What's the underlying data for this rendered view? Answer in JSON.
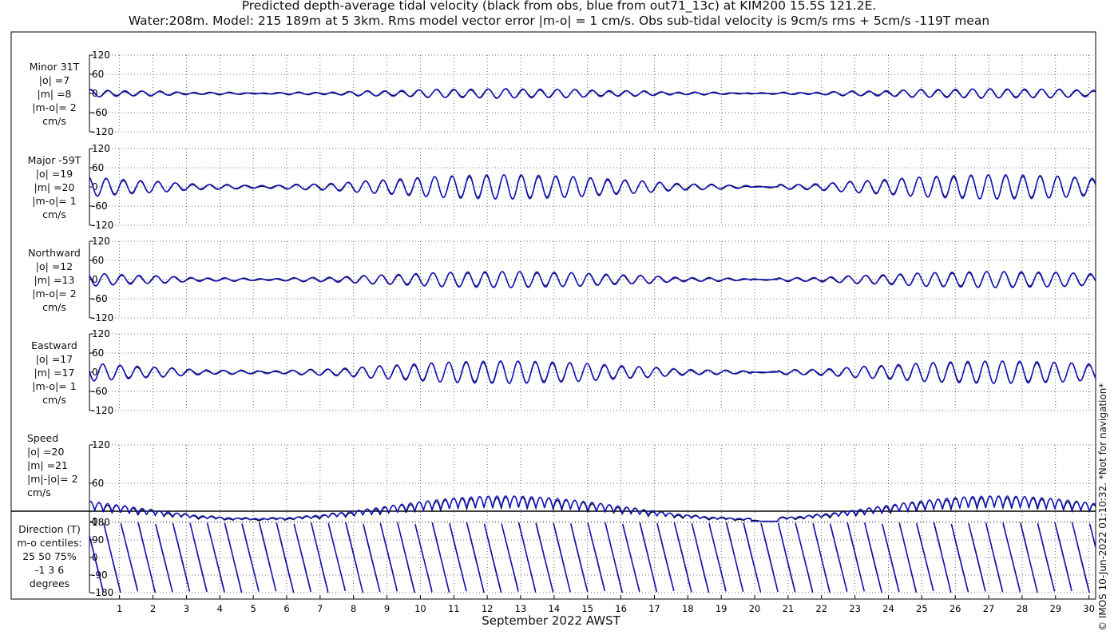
{
  "header": {
    "title_line1": "Predicted depth-average tidal velocity (black from obs, blue from out71_13c) at KIM200 15.5S 121.2E.",
    "title_line2": "Water:208m. Model: 215 189m at 5 3km. Rms model vector error |m-o| = 1 cm/s. Obs sub-tidal velocity is 9cm/s rms + 5cm/s -119T mean"
  },
  "panels": [
    {
      "lines": [
        "Minor 31T",
        "|o| =7",
        "|m| =8",
        "|m-o|= 2",
        "cm/s"
      ]
    },
    {
      "lines": [
        "Major -59T",
        "|o| =19",
        "|m| =20",
        "|m-o|= 1",
        "cm/s"
      ]
    },
    {
      "lines": [
        "Northward",
        "|o| =12",
        "|m| =13",
        "|m-o|= 2",
        "cm/s"
      ]
    },
    {
      "lines": [
        "Eastward",
        "|o| =17",
        "|m| =17",
        "|m-o|= 1",
        "cm/s"
      ]
    },
    {
      "lines": [
        "Speed",
        "|o| =20",
        "|m| =21",
        "|m|-|o|= 2",
        "cm/s"
      ]
    },
    {
      "lines": [
        "Direction (T)",
        "m-o centiles:",
        "25  50  75%",
        "-1  3  6",
        "degrees"
      ]
    }
  ],
  "x_axis_label": "September 2022 AWST",
  "watermark": "© IMOS 10-Jun-2022 01:10:32. *Not for navigation*",
  "colors": {
    "obs": "#000000",
    "model": "#1010c8",
    "grid": "#444444"
  },
  "chart_data": {
    "type": "line",
    "x_unit": "day of September 2022",
    "x_range": [
      0.1,
      30.2
    ],
    "x_ticks": [
      1,
      2,
      3,
      4,
      5,
      6,
      7,
      8,
      9,
      10,
      11,
      12,
      13,
      14,
      15,
      16,
      17,
      18,
      19,
      20,
      21,
      22,
      23,
      24,
      25,
      26,
      27,
      28,
      29,
      30
    ],
    "series": [
      {
        "name": "black from obs"
      },
      {
        "name": "blue from out71_13c"
      }
    ],
    "panels": [
      {
        "id": "minor",
        "ylim": [
          -120,
          120
        ],
        "yticks": [
          -120,
          -60,
          0,
          60,
          120
        ],
        "rms_obs": 7,
        "rms_model": 8,
        "rms_error": 2
      },
      {
        "id": "major",
        "ylim": [
          -120,
          120
        ],
        "yticks": [
          -120,
          -60,
          0,
          60,
          120
        ],
        "rms_obs": 19,
        "rms_model": 20,
        "rms_error": 1
      },
      {
        "id": "northward",
        "ylim": [
          -120,
          120
        ],
        "yticks": [
          -120,
          -60,
          0,
          60,
          120
        ],
        "rms_obs": 12,
        "rms_model": 13,
        "rms_error": 2
      },
      {
        "id": "eastward",
        "ylim": [
          -120,
          120
        ],
        "yticks": [
          -120,
          -60,
          0,
          60,
          120
        ],
        "rms_obs": 17,
        "rms_model": 17,
        "rms_error": 1
      },
      {
        "id": "speed",
        "ylim": [
          0,
          120
        ],
        "yticks": [
          0,
          60,
          120
        ],
        "rms_obs": 20,
        "rms_model": 21,
        "rms_error": 2
      },
      {
        "id": "direction",
        "ylim": [
          -180,
          180
        ],
        "yticks": [
          -180,
          -90,
          0,
          90,
          180
        ],
        "centiles": [
          -1,
          3,
          6
        ]
      }
    ],
    "tidal_signal": {
      "semidiurnal_period_days": 0.5175,
      "spring_neap_period_days": 14.77,
      "amplitude_peak_days": [
        12.5,
        27.5
      ],
      "amplitude_trough_day": 20.3,
      "amplitude_cm_s": {
        "minor": 14,
        "major": 38,
        "northward": 25,
        "eastward": 35,
        "speed": 40
      }
    }
  }
}
